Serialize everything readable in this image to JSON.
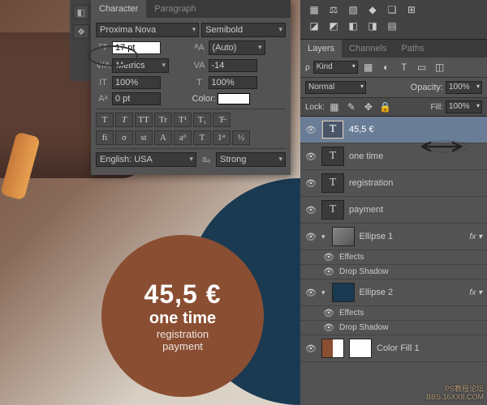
{
  "canvas": {
    "price": "45,5 €",
    "one_time": "one time",
    "registration": "registration",
    "payment": "payment"
  },
  "char_panel": {
    "tab_character": "Character",
    "tab_paragraph": "Paragraph",
    "font_family": "Proxima Nova",
    "font_style": "Semibold",
    "font_size": "17 pt",
    "leading": "(Auto)",
    "metrics": "Metrics",
    "tracking": "-14",
    "vscale": "100%",
    "hscale": "100%",
    "baseline": "0 pt",
    "color_label": "Color:",
    "btns1": [
      "T",
      "T",
      "TT",
      "Tr",
      "T¹",
      "T₁",
      "T̶"
    ],
    "btns2": [
      "fi",
      "σ",
      "st",
      "A",
      "aᵈ",
      "T",
      "1ˢᵗ",
      "½"
    ],
    "lang": "English: USA",
    "aa_label": "aₐ",
    "aa_value": "Strong",
    "size_icon": "ᵀT",
    "lead_icon": "ᴬA",
    "kern_icon": "V/A",
    "track_icon": "VA",
    "vsc_icon": "IT",
    "hsc_icon": "T",
    "bl_icon": "Aᵃ"
  },
  "layers_panel": {
    "tab_layers": "Layers",
    "tab_channels": "Channels",
    "tab_paths": "Paths",
    "kind": "Kind",
    "blend_mode": "Normal",
    "opacity_label": "Opacity:",
    "opacity_value": "100%",
    "lock_label": "Lock:",
    "fill_label": "Fill:",
    "fill_value": "100%",
    "layers": [
      {
        "name": "45,5 €",
        "type": "T",
        "selected": true
      },
      {
        "name": "one time",
        "type": "T"
      },
      {
        "name": "registration",
        "type": "T"
      },
      {
        "name": "payment",
        "type": "T"
      },
      {
        "name": "Ellipse 1",
        "type": "shape",
        "fx": true,
        "fx_items": [
          "Effects",
          "Drop Shadow"
        ]
      },
      {
        "name": "Ellipse 2",
        "type": "shape",
        "fx": true,
        "fx_items": [
          "Effects",
          "Drop Shadow"
        ]
      },
      {
        "name": "Color Fill 1",
        "type": "fill"
      }
    ]
  },
  "watermark": {
    "l1": "PS教程论坛",
    "l2": "BBS.16XX8.COM"
  }
}
